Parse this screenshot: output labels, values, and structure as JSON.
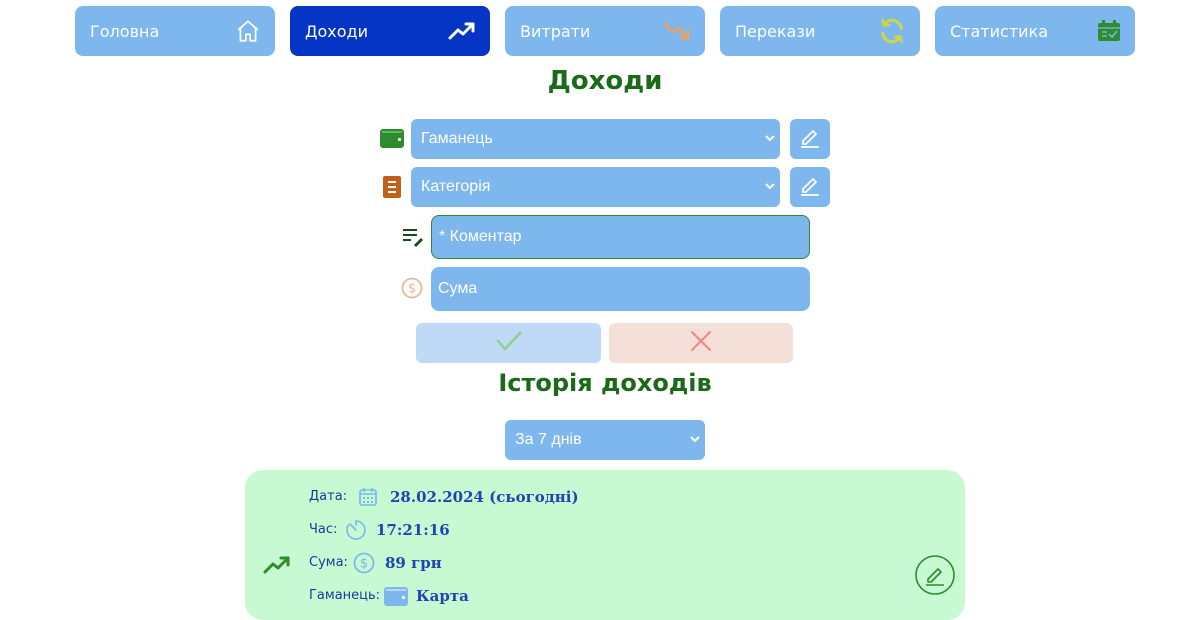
{
  "nav": {
    "items": [
      {
        "label": "Головна",
        "icon": "home-icon"
      },
      {
        "label": "Доходи",
        "icon": "trending-up-icon",
        "active": true
      },
      {
        "label": "Витрати",
        "icon": "trending-down-icon"
      },
      {
        "label": "Перекази",
        "icon": "refresh-icon"
      },
      {
        "label": "Статистика",
        "icon": "calendar-check-icon"
      }
    ]
  },
  "form": {
    "title": "Доходи",
    "wallet_select": "Гаманець",
    "category_select": "Категорія",
    "comment_placeholder": "* Коментар",
    "amount_placeholder": "Сума"
  },
  "history": {
    "title": "Історія доходів",
    "period_select": "За 7 днів",
    "entry": {
      "date_label": "Дата:",
      "date_value": "28.02.2024 (сьогодні)",
      "time_label": "Час:",
      "time_value": "17:21:16",
      "amount_label": "Сума:",
      "amount_value": "89 грн",
      "wallet_label": "Гаманець:",
      "wallet_value": "Карта"
    }
  },
  "colors": {
    "nav_bg": "#7eb6ee",
    "nav_active": "#0435c4",
    "title_green": "#1a6a1a",
    "card_bg": "#c7f9d2",
    "confirm_bg": "#bfdaf7",
    "cancel_bg": "#f4e0d8"
  }
}
